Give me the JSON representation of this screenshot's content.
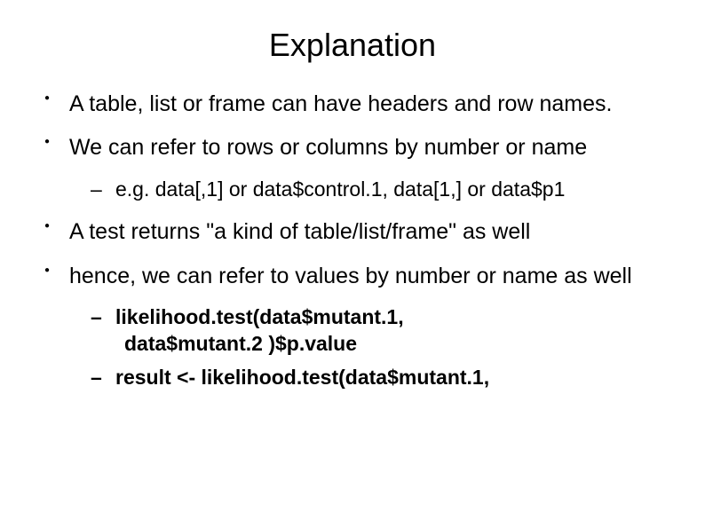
{
  "title": "Explanation",
  "bullets": {
    "b1": "A table, list or frame can have headers and row names.",
    "b2": "We can refer to rows or columns by number or name",
    "b2_sub1": "e.g. data[,1] or data$control.1, data[1,] or data$p1",
    "b3": "A test returns \"a kind of table/list/frame\" as well",
    "b4": "hence, we can refer to values by number or name as well",
    "b4_sub1_line1": "likelihood.test(data$mutant.1,",
    "b4_sub1_line2": " data$mutant.2 )$p.value",
    "b4_sub2": "result <- likelihood.test(data$mutant.1,"
  }
}
